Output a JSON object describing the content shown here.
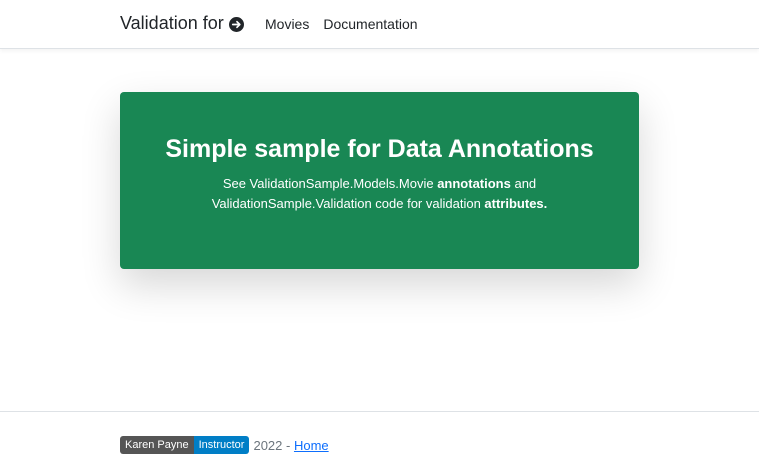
{
  "navbar": {
    "brand": "Validation for",
    "brand_icon": "arrow-right-circle-icon",
    "links": [
      "Movies",
      "Documentation"
    ]
  },
  "hero": {
    "title": "Simple sample for Data Annotations",
    "text_part1": "See ValidationSample.Models.Movie ",
    "text_bold1": "annotations",
    "text_part2": " and ValidationSample.Validation code for validation ",
    "text_bold2": "attributes.",
    "background_color": "#198754"
  },
  "footer": {
    "badge_left": "Karen Payne",
    "badge_right": "Instructor",
    "year_text": "2022 - ",
    "home_link": "Home"
  }
}
